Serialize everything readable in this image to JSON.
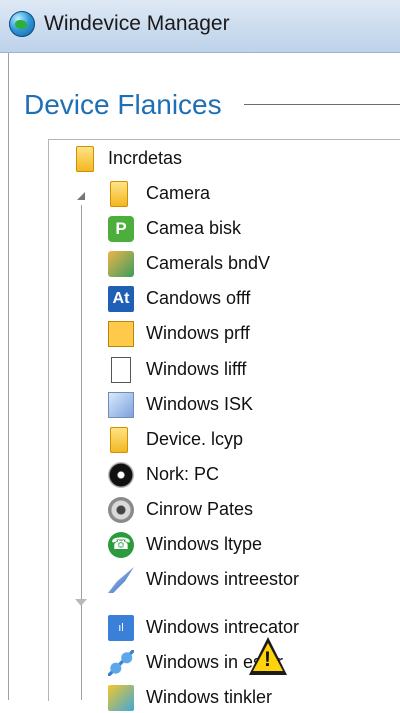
{
  "window": {
    "title": "Windevice Manager",
    "app_icon": "globe-icon"
  },
  "section": {
    "title": "Device Flanices"
  },
  "tree": {
    "root": {
      "label": "Incrdetas",
      "icon": "folder-icon"
    },
    "items": [
      {
        "label": "Camera",
        "icon": "folder-icon"
      },
      {
        "label": "Camea bisk",
        "icon": "green-link-icon"
      },
      {
        "label": "Camerals bndV",
        "icon": "camera-network-icon"
      },
      {
        "label": "Candows offf",
        "icon": "text-tool-icon"
      },
      {
        "label": "Windows prff",
        "icon": "warning-document-icon"
      },
      {
        "label": "Windows lifff",
        "icon": "document-icon"
      },
      {
        "label": "Windows ISK",
        "icon": "pen-icon"
      },
      {
        "label": "Device. lcyp",
        "icon": "folder-icon"
      },
      {
        "label": "Nork: PC",
        "icon": "disc-icon"
      },
      {
        "label": "Cinrow Pates",
        "icon": "ring-icon"
      },
      {
        "label": "Windows ltype",
        "icon": "phone-icon"
      },
      {
        "label": "Windows intreestor",
        "icon": "edit-icon"
      },
      {
        "label": "Windows intrecator",
        "icon": "blue-chart-icon"
      },
      {
        "label": "Windows in    estor",
        "icon": "connection-icon"
      },
      {
        "label": "Windows tinkler",
        "icon": "network-icon"
      }
    ],
    "warning_icon": "warning-icon"
  }
}
